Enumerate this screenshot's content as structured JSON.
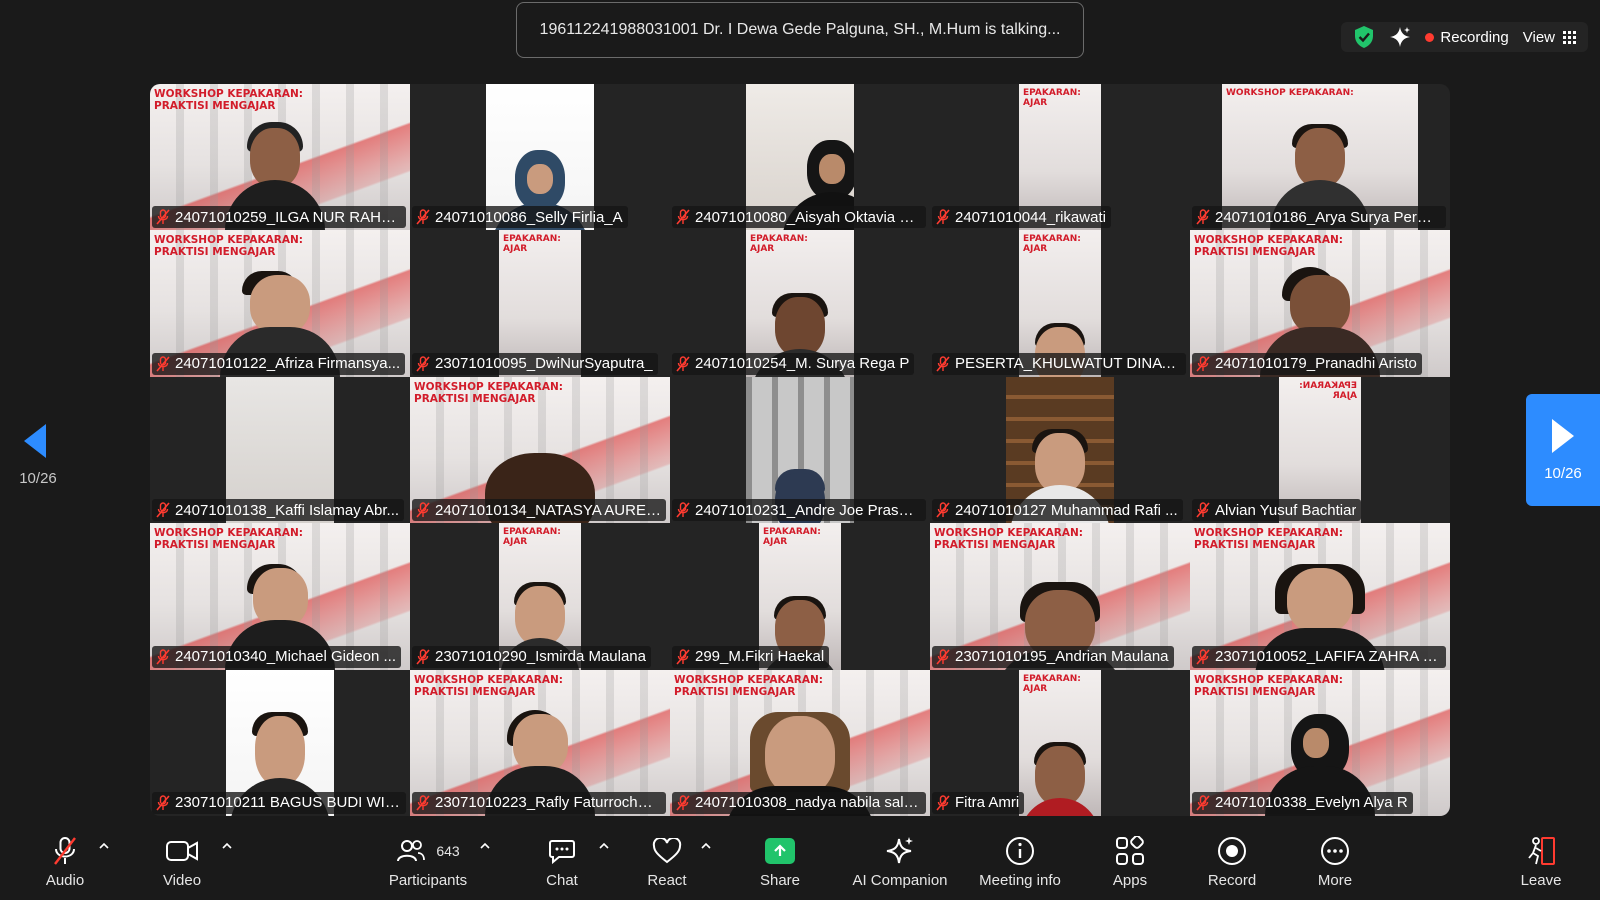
{
  "meeting": {
    "talking_banner": "196112241988031001 Dr. I Dewa Gede Palguna, SH., M.Hum is talking...",
    "recording_label": "Recording",
    "view_label": "View",
    "page_indicator": "10/26",
    "status_colors": {
      "recording": "#ff3b30",
      "shield": "#21c46b",
      "accent": "#2d8cff"
    }
  },
  "banner_text": {
    "line1": "WORKSHOP KEPAKARAN:",
    "line2": "PRAKTISI MENGAJAR",
    "short1": "EPAKARAN:",
    "short2": "AJAR"
  },
  "participants": [
    {
      "name": "24071010259_ILGA NUR RAHM...",
      "muted": true
    },
    {
      "name": "24071010086_Selly Firlia_A",
      "muted": true
    },
    {
      "name": "24071010080_Aisyah Oktavia D...",
      "muted": true
    },
    {
      "name": "24071010044_rikawati",
      "muted": true
    },
    {
      "name": "24071010186_Arya Surya Perm...",
      "muted": true
    },
    {
      "name": "24071010122_Afriza Firmansya...",
      "muted": true
    },
    {
      "name": "23071010095_DwiNurSyaputra_",
      "muted": true
    },
    {
      "name": "24071010254_M. Surya Rega P",
      "muted": true
    },
    {
      "name": "PESERTA_KHULWATUT DINAYA...",
      "muted": true
    },
    {
      "name": "24071010179_Pranadhi Aristo",
      "muted": true
    },
    {
      "name": "24071010138_Kaffi Islamay Abr...",
      "muted": true
    },
    {
      "name": "24071010134_NATASYA AUREL...",
      "muted": true
    },
    {
      "name": "24071010231_Andre Joe Praset...",
      "muted": true
    },
    {
      "name": "24071010127 Muhammad Rafi ...",
      "muted": true
    },
    {
      "name": "Alvian Yusuf Bachtiar",
      "muted": true
    },
    {
      "name": "24071010340_Michael Gideon ...",
      "muted": true
    },
    {
      "name": "23071010290_Ismirda Maulana",
      "muted": true
    },
    {
      "name": "299_M.Fikri Haekal",
      "muted": true
    },
    {
      "name": "23071010195_Andrian Maulana",
      "muted": true
    },
    {
      "name": "23071010052_LAFIFA ZAHRA M...",
      "muted": true
    },
    {
      "name": "23071010211 BAGUS BUDI WIB...",
      "muted": true
    },
    {
      "name": "23071010223_Rafly Faturrochm...",
      "muted": true
    },
    {
      "name": "24071010308_nadya nabila sals...",
      "muted": true
    },
    {
      "name": "Fitra Amri",
      "muted": true
    },
    {
      "name": "24071010338_Evelyn Alya R",
      "muted": true
    }
  ],
  "toolbar": {
    "audio": "Audio",
    "video": "Video",
    "participants": "Participants",
    "participants_count": "643",
    "chat": "Chat",
    "react": "React",
    "share": "Share",
    "ai_companion": "AI Companion",
    "meeting_info": "Meeting info",
    "apps": "Apps",
    "record": "Record",
    "more": "More",
    "leave": "Leave"
  }
}
